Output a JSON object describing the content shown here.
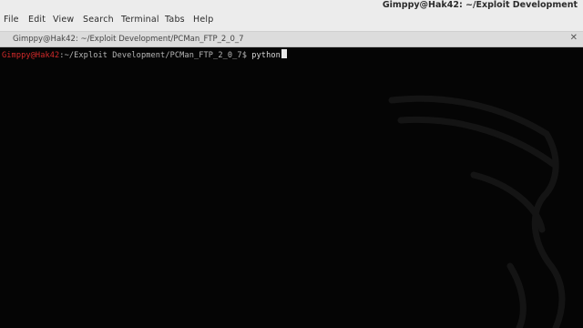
{
  "menu": {
    "items": [
      {
        "id": "file",
        "label": "File"
      },
      {
        "id": "edit",
        "label": "Edit"
      },
      {
        "id": "view",
        "label": "View"
      },
      {
        "id": "search",
        "label": "Search"
      },
      {
        "id": "terminal",
        "label": "Terminal"
      },
      {
        "id": "tabs",
        "label": "Tabs"
      },
      {
        "id": "help",
        "label": "Help"
      }
    ]
  },
  "window": {
    "title": "Gimppy@Hak42: ~/Exploit Development"
  },
  "tab": {
    "label": "Gimppy@Hak42: ~/Exploit Development/PCMan_FTP_2_0_7"
  },
  "terminal": {
    "prompt_user": "Gimppy@Hak42",
    "prompt_path": ":~/Exploit Development/PCMan_FTP_2_0_7$",
    "command": " python"
  },
  "colors": {
    "prompt_user": "#d22a2a",
    "background": "#050505",
    "menubar": "#ececec"
  }
}
